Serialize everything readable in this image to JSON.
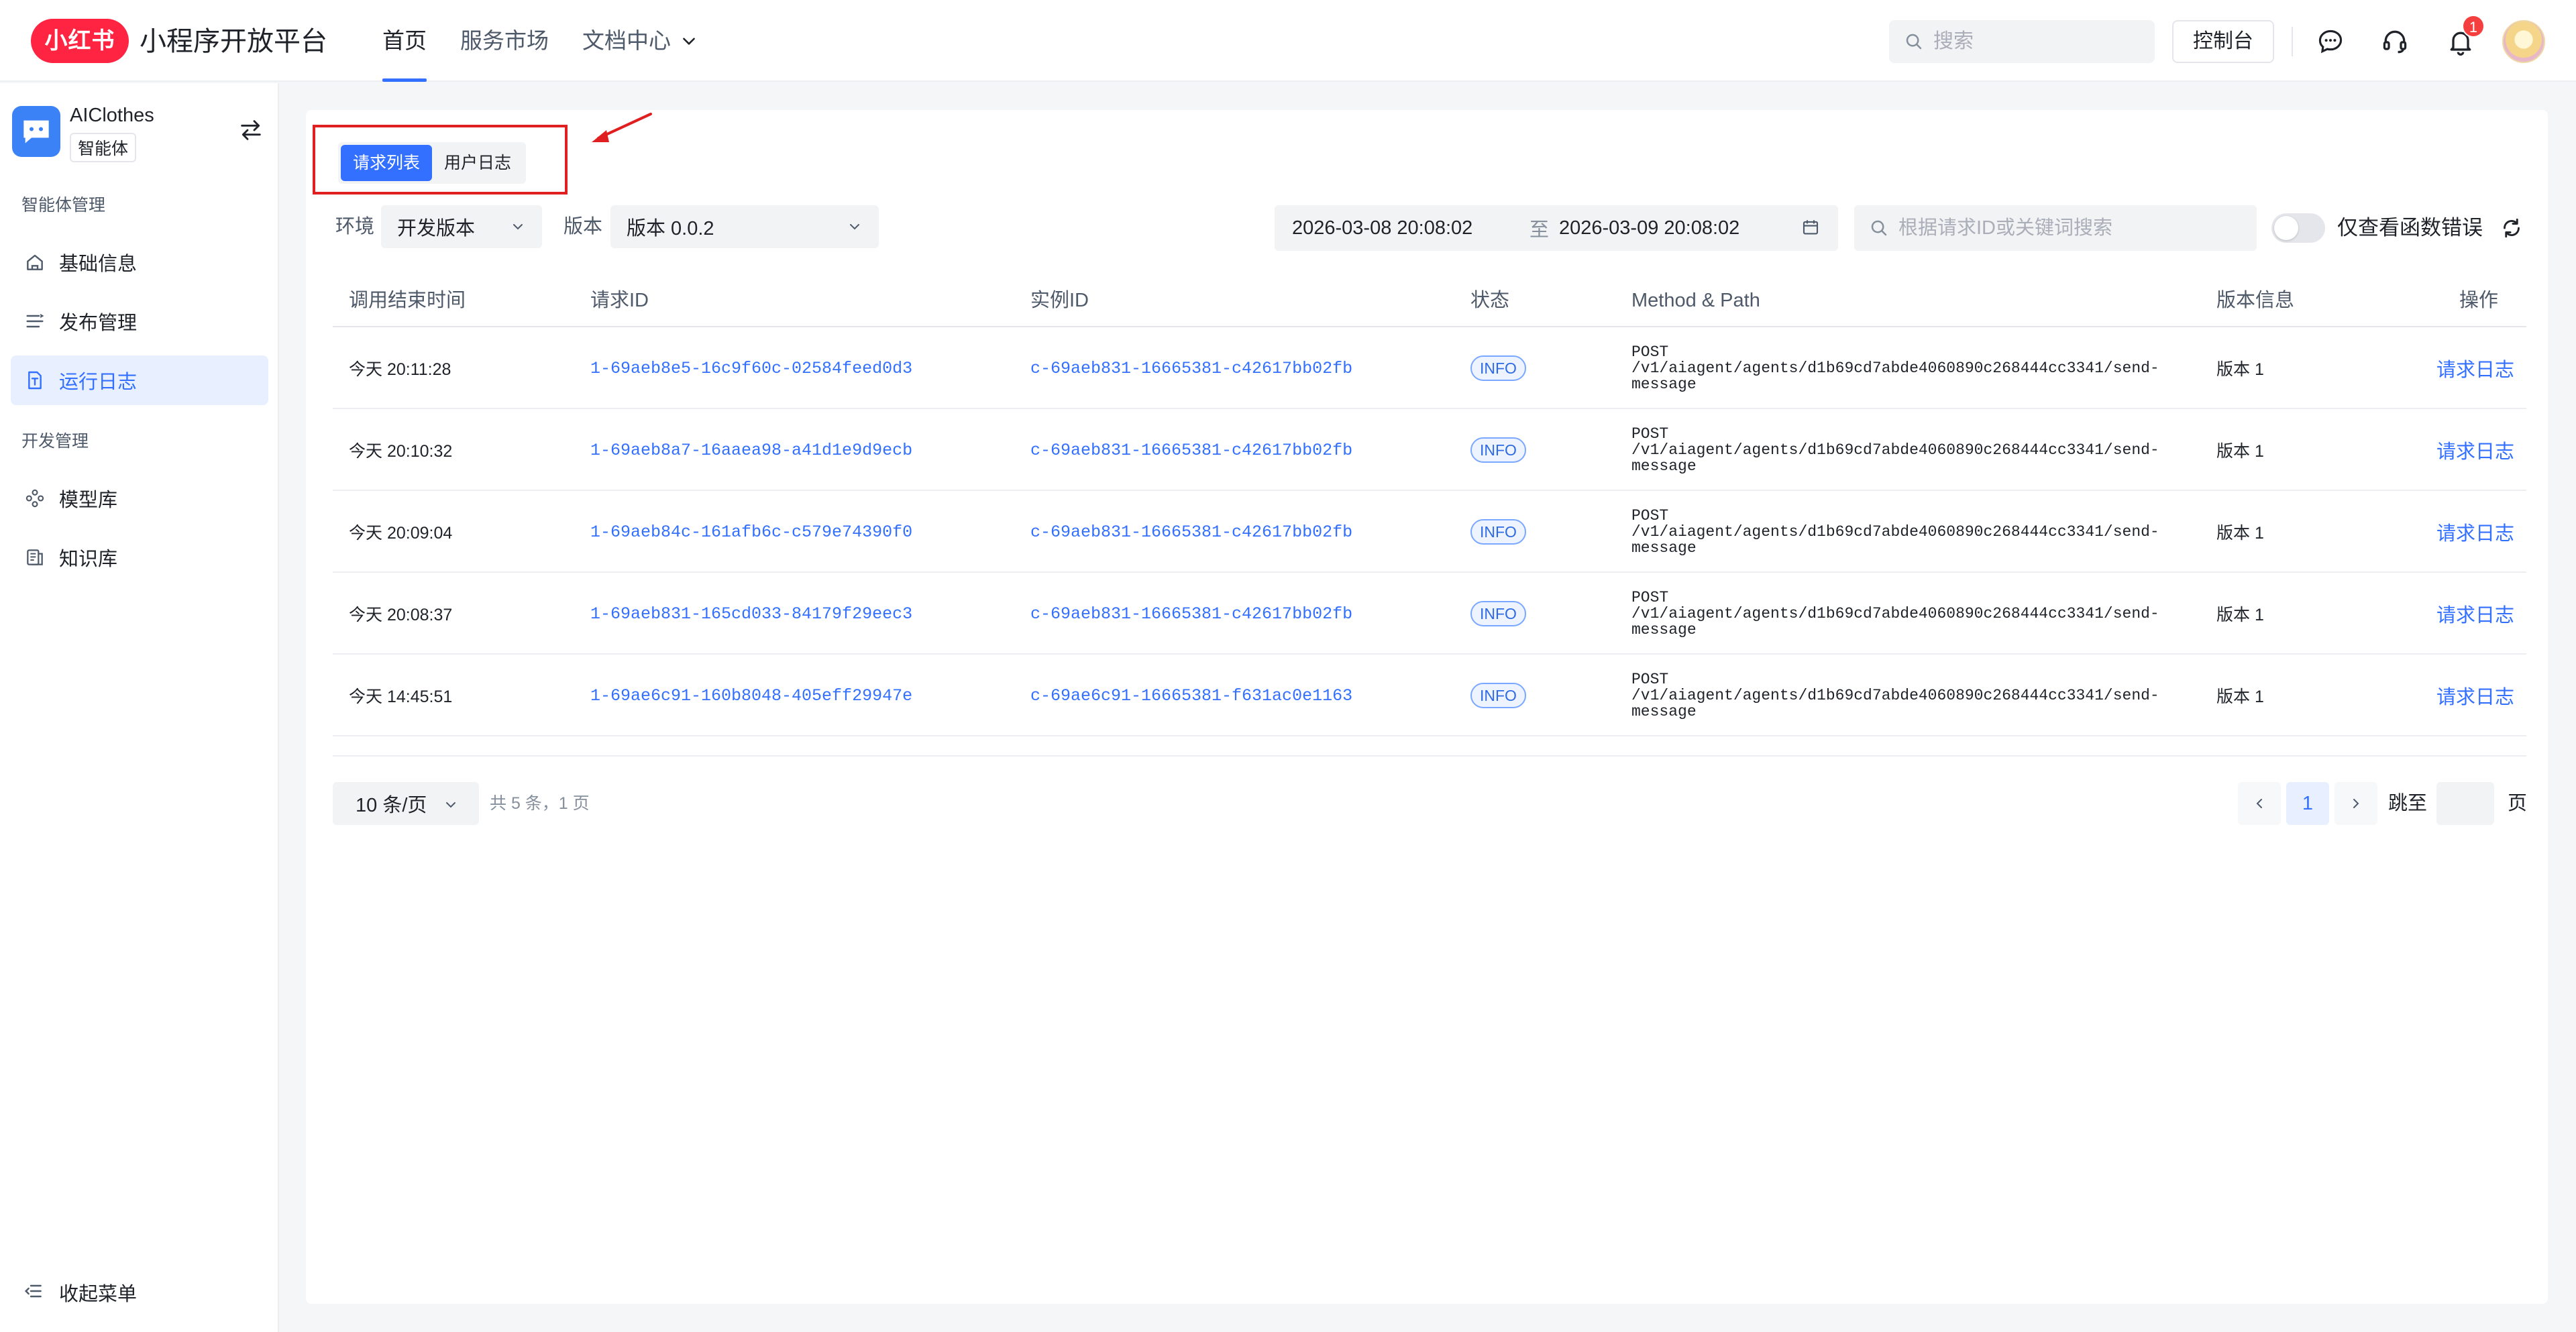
{
  "header": {
    "logo_text": "小红书",
    "platform_title": "小程序开放平台",
    "nav": [
      {
        "label": "首页"
      },
      {
        "label": "服务市场"
      },
      {
        "label": "文档中心"
      }
    ],
    "search_placeholder": "搜索",
    "console_label": "控制台",
    "notification_count": "1",
    "icons": [
      "search-icon",
      "message-icon",
      "headset-icon",
      "bell-icon",
      "avatar"
    ]
  },
  "sidebar": {
    "app_name": "AIClothes",
    "app_tag": "智能体",
    "group1_title": "智能体管理",
    "group1_items": [
      {
        "label": "基础信息",
        "icon": "home-icon"
      },
      {
        "label": "发布管理",
        "icon": "list-icon"
      },
      {
        "label": "运行日志",
        "icon": "log-file-icon",
        "active": true
      }
    ],
    "group2_title": "开发管理",
    "group2_items": [
      {
        "label": "模型库",
        "icon": "model-icon"
      },
      {
        "label": "知识库",
        "icon": "knowledge-icon"
      }
    ],
    "collapse_label": "收起菜单"
  },
  "main": {
    "tabs": [
      {
        "label": "请求列表",
        "active": true
      },
      {
        "label": "用户日志",
        "active": false
      }
    ],
    "filters": {
      "env_label": "环境",
      "env_value": "开发版本",
      "version_label": "版本",
      "version_value": "版本 0.0.2",
      "date_start": "2026-03-08 20:08:02",
      "date_sep": "至",
      "date_end": "2026-03-09 20:08:02",
      "keyword_placeholder": "根据请求ID或关键词搜索",
      "only_errors_label": "仅查看函数错误"
    },
    "table": {
      "columns": [
        "调用结束时间",
        "请求ID",
        "实例ID",
        "状态",
        "Method & Path",
        "版本信息",
        "操作"
      ],
      "rows": [
        {
          "time": "今天 20:11:28",
          "request_id": "1-69aeb8e5-16c9f60c-02584feed0d3",
          "instance_id": "c-69aeb831-16665381-c42617bb02fb",
          "status": "INFO",
          "method_path": "POST\n/v1/aiagent/agents/d1b69cd7abde4060890c268444cc3341/send-\nmessage",
          "version": "版本 1",
          "action": "请求日志"
        },
        {
          "time": "今天 20:10:32",
          "request_id": "1-69aeb8a7-16aaea98-a41d1e9d9ecb",
          "instance_id": "c-69aeb831-16665381-c42617bb02fb",
          "status": "INFO",
          "method_path": "POST\n/v1/aiagent/agents/d1b69cd7abde4060890c268444cc3341/send-\nmessage",
          "version": "版本 1",
          "action": "请求日志"
        },
        {
          "time": "今天 20:09:04",
          "request_id": "1-69aeb84c-161afb6c-c579e74390f0",
          "instance_id": "c-69aeb831-16665381-c42617bb02fb",
          "status": "INFO",
          "method_path": "POST\n/v1/aiagent/agents/d1b69cd7abde4060890c268444cc3341/send-\nmessage",
          "version": "版本 1",
          "action": "请求日志"
        },
        {
          "time": "今天 20:08:37",
          "request_id": "1-69aeb831-165cd033-84179f29eec3",
          "instance_id": "c-69aeb831-16665381-c42617bb02fb",
          "status": "INFO",
          "method_path": "POST\n/v1/aiagent/agents/d1b69cd7abde4060890c268444cc3341/send-\nmessage",
          "version": "版本 1",
          "action": "请求日志"
        },
        {
          "time": "今天 14:45:51",
          "request_id": "1-69ae6c91-160b8048-405eff29947e",
          "instance_id": "c-69ae6c91-16665381-f631ac0e1163",
          "status": "INFO",
          "method_path": "POST\n/v1/aiagent/agents/d1b69cd7abde4060890c268444cc3341/send-\nmessage",
          "version": "版本 1",
          "action": "请求日志"
        }
      ]
    },
    "pagination": {
      "page_size": "10 条/页",
      "total": "共 5 条，1 页",
      "current_page": "1",
      "jump_label": "跳至",
      "page_suffix": "页"
    }
  },
  "colors": {
    "brand_red": "#ff2442",
    "accent_blue": "#3370ff",
    "annotation_red": "#e02020"
  }
}
